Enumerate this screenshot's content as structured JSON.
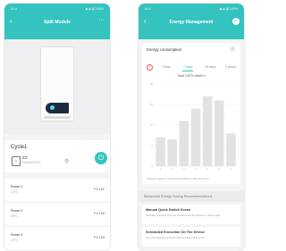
{
  "left_screen": {
    "status_time": "8:14",
    "status_right": "◆ ◈ ▥ 100%",
    "title": "Split Module",
    "back": "‹",
    "more": "···",
    "device": {
      "name": "Cycle1",
      "temp": "23°",
      "current": "Current 19°C",
      "thermo_label": "H",
      "gear": "⚙",
      "power": "⏻"
    },
    "rooms": [
      {
        "name": "Room 1",
        "temp": "17°C",
        "id": "F1-101"
      },
      {
        "name": "Room 2",
        "temp": "20°C",
        "id": "F1-102"
      },
      {
        "name": "Room 3",
        "temp": "17°C",
        "id": "F1-103"
      }
    ]
  },
  "right_screen": {
    "status_time": "8:14",
    "status_right": "◆ ◈ ▥ 100%",
    "title": "Energy Management",
    "back": "‹",
    "check": "✓",
    "energy": {
      "title": "Energy consumption",
      "button": "≡",
      "alert": "!",
      "tabs": [
        "Today",
        "7 days",
        "30 days",
        "1 years"
      ],
      "active_tab": "7 days",
      "total": "Total 3.87% 0kWh h",
      "note": "Energy saving is estimated and there may be errors"
    },
    "section": "Behavioral Energy Saving Recommendations",
    "scenes": [
      {
        "title": "Manual Quick Switch Scene",
        "desc": "Manually executed shortcut functions can be placed on home page"
      },
      {
        "title": "Scheduled Execution On The Device",
        "desc": "Can automatically control equipment according to the"
      }
    ]
  },
  "chart_data": {
    "type": "bar",
    "categories": [
      "1",
      "2",
      "3",
      "4",
      "5",
      "6",
      "7"
    ],
    "values": [
      7,
      6.5,
      11,
      14,
      17,
      16,
      8
    ],
    "ylim": [
      0,
      20
    ],
    "yticks": [
      "20",
      "15",
      "10",
      "5",
      "0"
    ],
    "bar_color": "#e2e2e2",
    "grid": true
  },
  "colors": {
    "accent": "#34c3be",
    "alert": "#e55555"
  }
}
